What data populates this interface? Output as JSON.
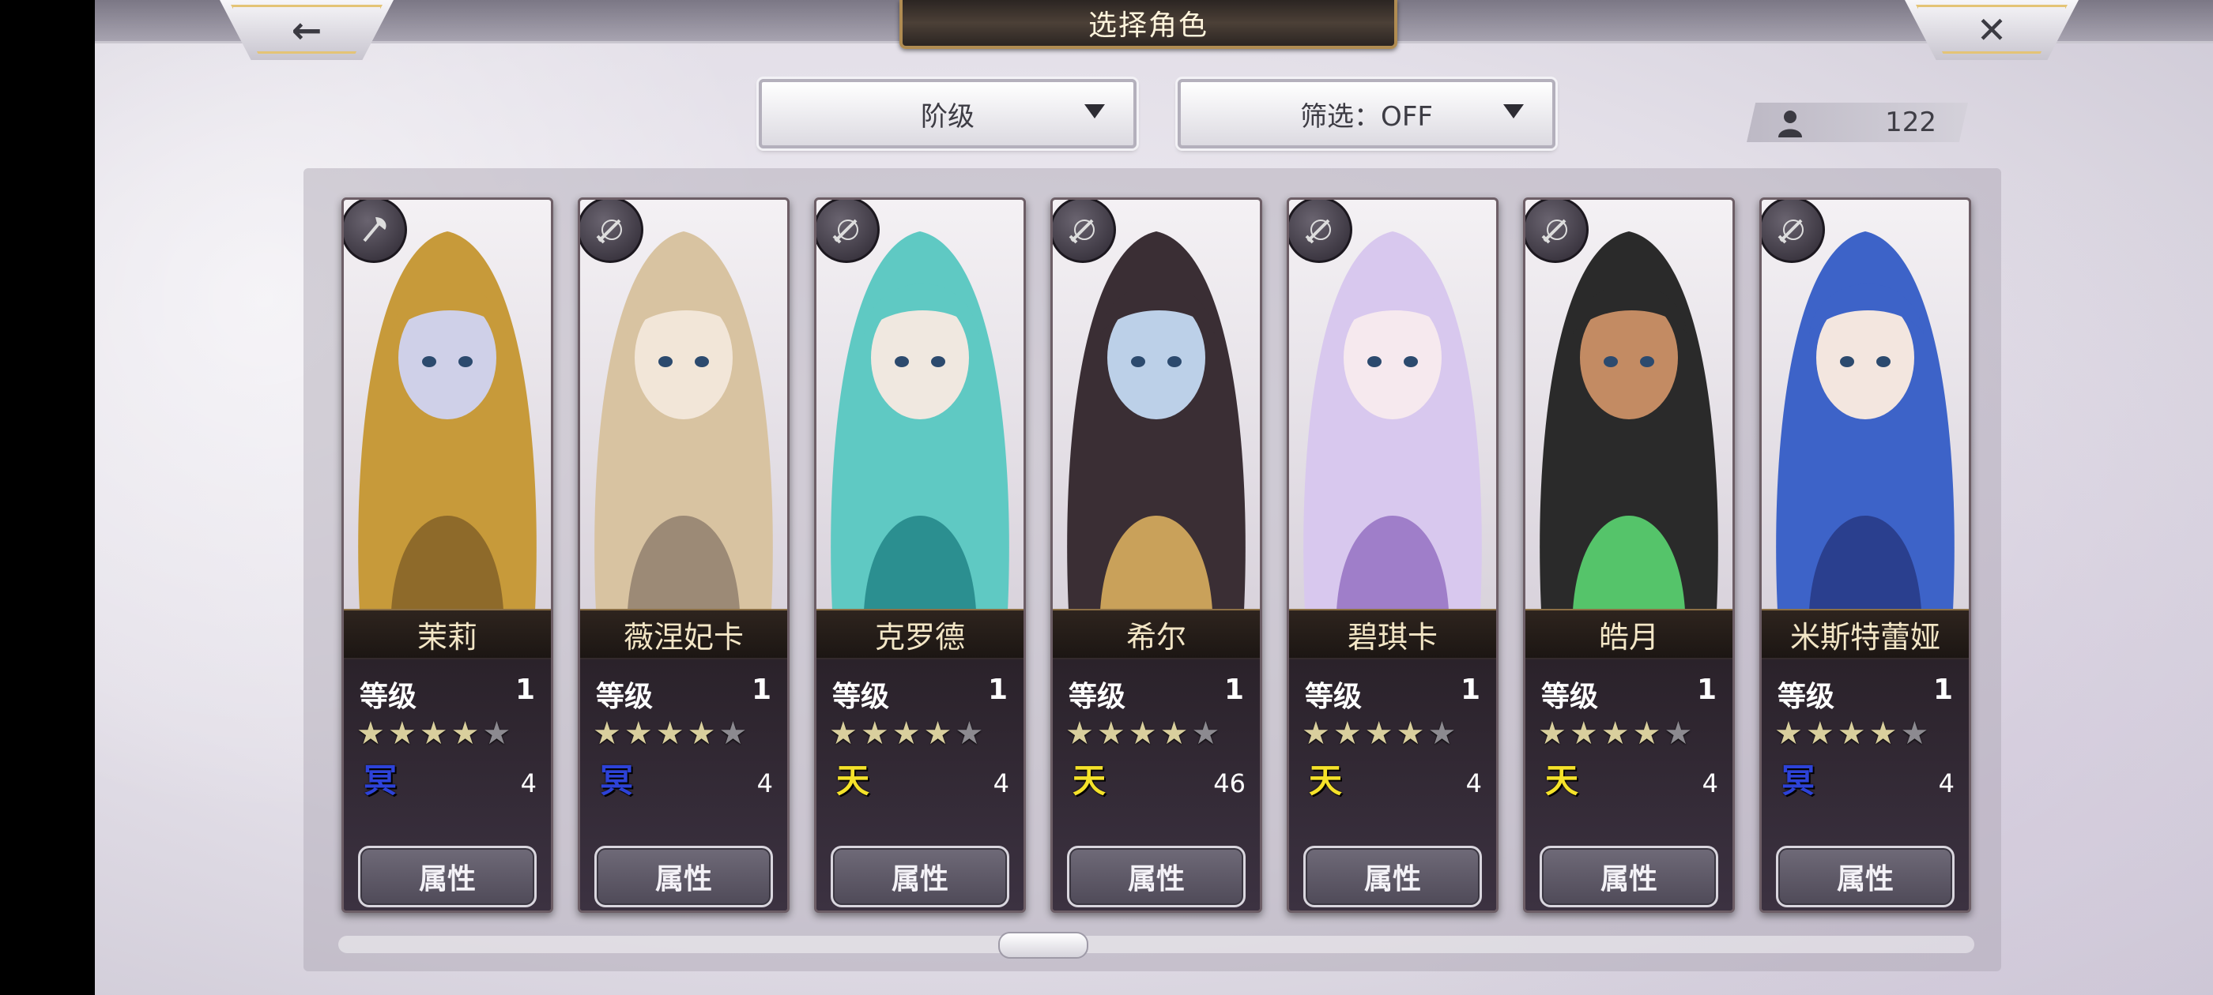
{
  "header": {
    "title": "选择角色",
    "back_icon": "←",
    "close_icon": "✕"
  },
  "filters": {
    "rank_label": "阶级",
    "filter_label": "筛选：OFF"
  },
  "character_count": "122",
  "cards": [
    {
      "name": "茉莉",
      "level_label": "等级",
      "level": "1",
      "stars": 4,
      "element": "冥",
      "element_color": "#2d42d8",
      "count": "4",
      "attr_label": "属性",
      "class_icon": "axe-icon"
    },
    {
      "name": "薇涅妃卡",
      "level_label": "等级",
      "level": "1",
      "stars": 4,
      "element": "冥",
      "element_color": "#2d42d8",
      "count": "4",
      "attr_label": "属性",
      "class_icon": "sword-icon"
    },
    {
      "name": "克罗德",
      "level_label": "等级",
      "level": "1",
      "stars": 4,
      "element": "天",
      "element_color": "#f5e22a",
      "count": "4",
      "attr_label": "属性",
      "class_icon": "sword-icon"
    },
    {
      "name": "希尔",
      "level_label": "等级",
      "level": "1",
      "stars": 4,
      "element": "天",
      "element_color": "#f5e22a",
      "count": "46",
      "attr_label": "属性",
      "class_icon": "sword-icon"
    },
    {
      "name": "碧琪卡",
      "level_label": "等级",
      "level": "1",
      "stars": 4,
      "element": "天",
      "element_color": "#f5e22a",
      "count": "4",
      "attr_label": "属性",
      "class_icon": "sword-icon"
    },
    {
      "name": "皓月",
      "level_label": "等级",
      "level": "1",
      "stars": 4,
      "element": "天",
      "element_color": "#f5e22a",
      "count": "4",
      "attr_label": "属性",
      "class_icon": "sword-icon"
    },
    {
      "name": "米斯特蕾娅",
      "level_label": "等级",
      "level": "1",
      "stars": 4,
      "element": "冥",
      "element_color": "#2d42d8",
      "count": "4",
      "attr_label": "属性",
      "class_icon": "sword-icon"
    }
  ],
  "scroll_progress": 0.41
}
